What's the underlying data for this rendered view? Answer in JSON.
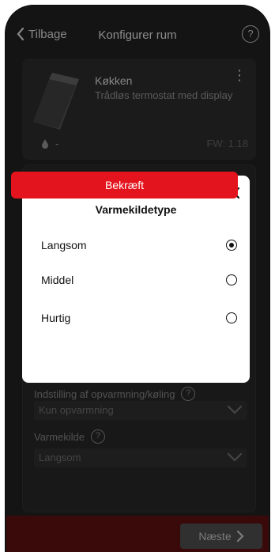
{
  "header": {
    "back_label": "Tilbage",
    "title": "Konfigurer rum",
    "help_icon": "?"
  },
  "device": {
    "name": "Køkken",
    "type": "Trådløs termostat med display",
    "humidity_value": "-",
    "firmware": "FW: 1.18"
  },
  "config": {
    "mode_label": "Indstilling af opvarmning/køling",
    "mode_value": "Kun opvarmning",
    "heat_source_label": "Varmekilde",
    "heat_source_value": "Langsom"
  },
  "footer": {
    "next_label": "Næste"
  },
  "modal": {
    "title": "Varmekildetype",
    "options": [
      {
        "label": "Langsom",
        "selected": true
      },
      {
        "label": "Middel",
        "selected": false
      },
      {
        "label": "Hurtig",
        "selected": false
      }
    ],
    "confirm_label": "Bekræft"
  },
  "colors": {
    "accent": "#e3141d",
    "background": "#202020",
    "modal_bg": "#ffffff"
  }
}
